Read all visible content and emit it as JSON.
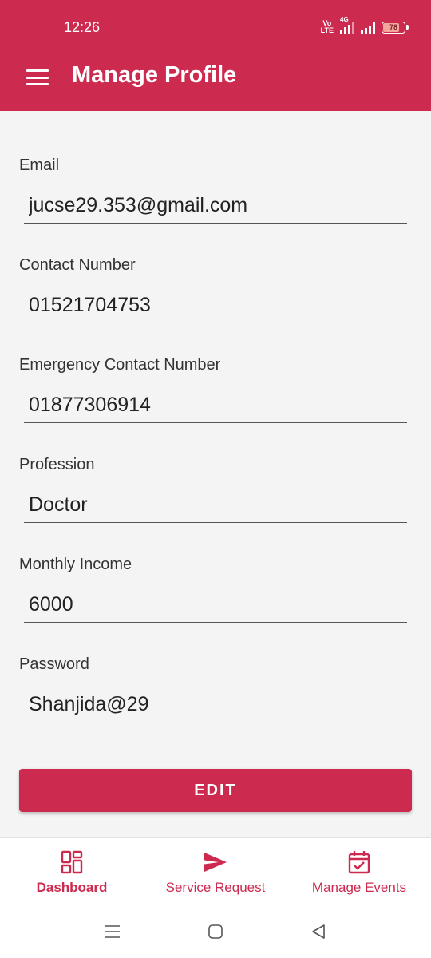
{
  "status_bar": {
    "time": "12:26",
    "volte": "Vo\nLTE",
    "network": "4G",
    "battery": "78"
  },
  "appbar": {
    "title": "Manage Profile",
    "menu_icon": "menu-icon",
    "color": "#cc2a4f"
  },
  "form": {
    "fields": [
      {
        "label": "Email",
        "value": "jucse29.353@gmail.com"
      },
      {
        "label": "Contact Number",
        "value": "01521704753"
      },
      {
        "label": "Emergency Contact Number",
        "value": "01877306914"
      },
      {
        "label": "Profession",
        "value": "Doctor"
      },
      {
        "label": "Monthly Income",
        "value": "6000"
      },
      {
        "label": "Password",
        "value": "Shanjida@29"
      }
    ],
    "edit_label": "EDIT"
  },
  "bottom_nav": {
    "items": [
      {
        "label": "Dashboard",
        "icon": "dashboard-icon",
        "active": true
      },
      {
        "label": "Service Request",
        "icon": "send-icon",
        "active": false
      },
      {
        "label": "Manage Events",
        "icon": "calendar-check-icon",
        "active": false
      }
    ]
  },
  "system_nav": [
    "recents-icon",
    "home-icon",
    "back-icon"
  ]
}
